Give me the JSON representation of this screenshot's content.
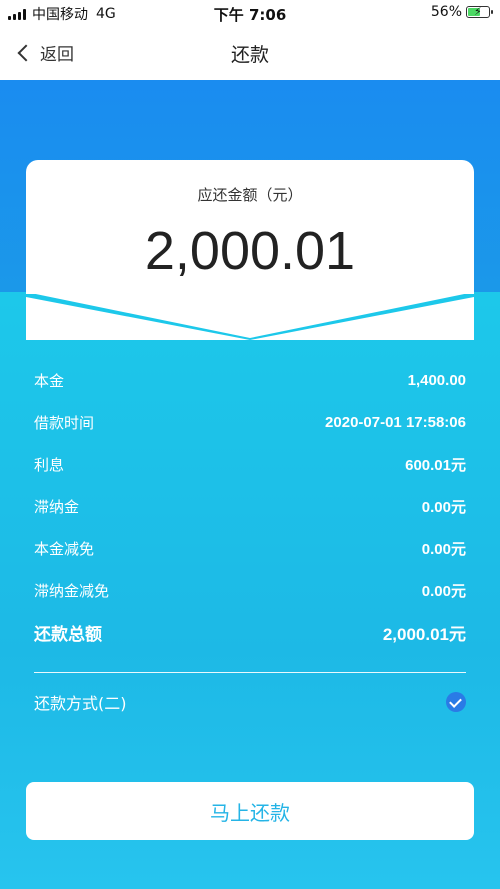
{
  "status_bar": {
    "carrier": "中国移动",
    "network": "4G",
    "time": "下午 7:06",
    "battery_percent": "56%",
    "battery_level": 0.56
  },
  "nav": {
    "back_label": "返回",
    "title": "还款"
  },
  "amount": {
    "label": "应还金额（元）",
    "value": "2,000.01"
  },
  "details": [
    {
      "label": "本金",
      "value": "1,400.00"
    },
    {
      "label": "借款时间",
      "value": "2020-07-01 17:58:06"
    },
    {
      "label": "利息",
      "value": "600.01元"
    },
    {
      "label": "滞纳金",
      "value": "0.00元"
    },
    {
      "label": "本金减免",
      "value": "0.00元"
    },
    {
      "label": "滞纳金减免",
      "value": "0.00元"
    }
  ],
  "total": {
    "label": "还款总额",
    "value": "2,000.01元"
  },
  "payment_method": {
    "label": "还款方式(二)",
    "selected": true
  },
  "pay_button": {
    "label": "马上还款"
  },
  "colors": {
    "gradient_top": "#1a8cf0",
    "gradient_bottom": "#2ec7ec",
    "check_blue": "#2a7be6",
    "button_text": "#25b4e6"
  }
}
